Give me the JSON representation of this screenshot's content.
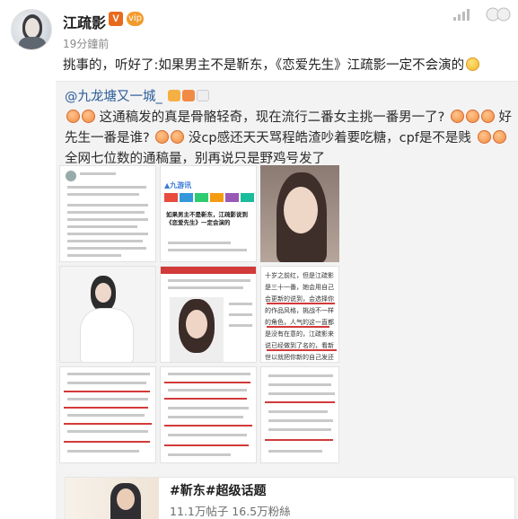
{
  "post": {
    "username": "江疏影",
    "verified_badge": "V",
    "vip_badge": "vip",
    "time": "19分鐘前",
    "text": "挑事的，听好了:如果男主不是靳东，《恋爱先生》江疏影一定不会演的"
  },
  "repost": {
    "author": "@九龙塘又一城_",
    "text_part1": "这通稿发的真是骨骼轻奇，现在流行二番女主挑一番男一了?",
    "text_part2": "好先生一番是谁?",
    "text_part3": "没cp感还天天骂程皓渣吵着要吃糖，cpf是不是贱",
    "text_part4": "全网七位数的通稿量，别再说只是野鸡号发了"
  },
  "images": {
    "thumb2_header": "▲九游讯",
    "thumb2_title": "如果男主不是靳东，江疏影说到《恋爱先生》一定会演的",
    "thumb6_text": "十岁之前红，但是江疏影是三十一番，她会用自己会更新的说到，会选择你的作品风格，挑战不一样的角色，人气的这一直都是没有在意的，江疏影来说已经做到了名的，看新世以就把你新的自己发还不会错误的时候，感觉江疏影未来的发展会越来越好"
  },
  "topic": {
    "title": "#靳东#超级话题",
    "stats": "11.1万帖子 16.5万粉絲"
  },
  "icons": [
    "avatar",
    "verified-icon",
    "vip-icon",
    "signal-icon",
    "emoji-icon",
    "panda-icon"
  ],
  "colors": {
    "link": "#2a5c9a",
    "badge": "#e86a1e",
    "highlight": "#d23a3a"
  }
}
